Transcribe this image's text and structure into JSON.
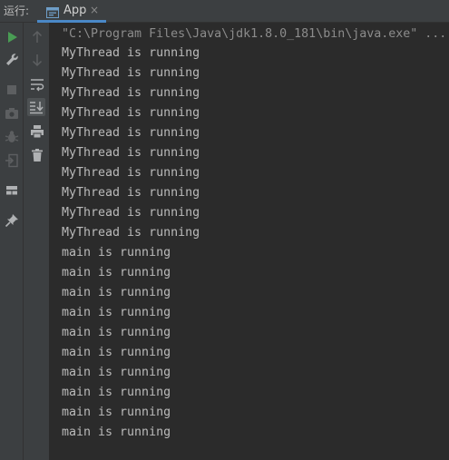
{
  "header": {
    "run_label": "运行:",
    "tab": {
      "label": "App",
      "close": "×"
    }
  },
  "colors": {
    "run_green": "#499c54",
    "tab_underline": "#4a88c7",
    "console_text": "#bbbbbb",
    "command_text": "#8c8c8c"
  },
  "left_toolbar": [
    {
      "name": "run-icon",
      "enabled": true
    },
    {
      "name": "wrench-icon",
      "enabled": true
    },
    {
      "name": "stop-icon",
      "enabled": false
    },
    {
      "name": "camera-icon",
      "enabled": false
    },
    {
      "name": "bug-icon",
      "enabled": false
    },
    {
      "name": "exit-icon",
      "enabled": false
    },
    {
      "name": "layout-icon",
      "enabled": true
    },
    {
      "name": "pin-icon",
      "enabled": true
    }
  ],
  "console_toolbar": [
    {
      "name": "arrow-up-icon",
      "enabled": false
    },
    {
      "name": "arrow-down-icon",
      "enabled": false
    },
    {
      "name": "soft-wrap-icon",
      "enabled": true
    },
    {
      "name": "scroll-to-end-icon",
      "enabled": true,
      "selected": true
    },
    {
      "name": "print-icon",
      "enabled": true
    },
    {
      "name": "trash-icon",
      "enabled": true
    }
  ],
  "console": {
    "command": "\"C:\\Program Files\\Java\\jdk1.8.0_181\\bin\\java.exe\" ...",
    "lines": [
      "MyThread is running",
      "MyThread is running",
      "MyThread is running",
      "MyThread is running",
      "MyThread is running",
      "MyThread is running",
      "MyThread is running",
      "MyThread is running",
      "MyThread is running",
      "MyThread is running",
      "main is running",
      "main is running",
      "main is running",
      "main is running",
      "main is running",
      "main is running",
      "main is running",
      "main is running",
      "main is running",
      "main is running"
    ]
  }
}
